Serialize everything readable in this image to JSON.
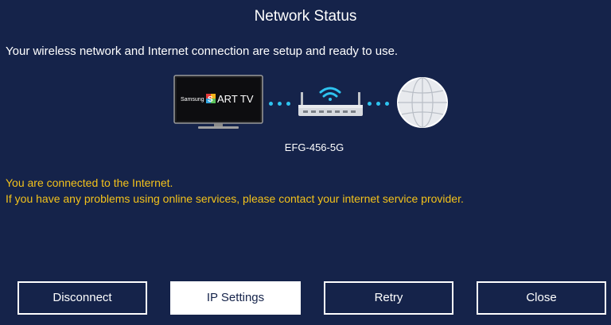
{
  "header": {
    "title": "Network Status"
  },
  "status": {
    "message": "Your wireless network and Internet connection are setup and ready to use."
  },
  "diagram": {
    "tv_brand": "Samsung",
    "tv_logo_s": "S",
    "tv_logo_rest": "ART TV",
    "ssid": "EFG-456-5G",
    "tv_icon": "tv-icon",
    "router_icon": "router-icon",
    "globe_icon": "globe-icon",
    "link_color": "#2ec4f0"
  },
  "connection": {
    "line1": "You are connected to the Internet.",
    "line2": "If you have any problems using online services, please contact your internet service provider."
  },
  "buttons": {
    "disconnect": "Disconnect",
    "ip_settings": "IP Settings",
    "retry": "Retry",
    "close": "Close"
  },
  "colors": {
    "background": "#15234a",
    "accent_text": "#f3c21b",
    "focus_bg": "#ffffff"
  }
}
